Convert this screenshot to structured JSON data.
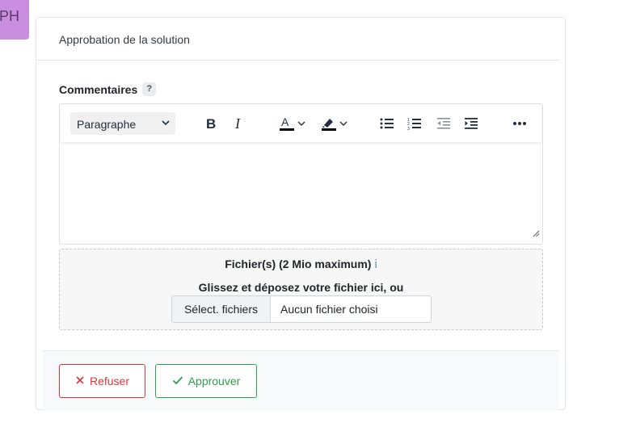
{
  "user": {
    "initials": "PH"
  },
  "card": {
    "title": "Approbation de la solution"
  },
  "comments": {
    "label": "Commentaires",
    "help": "?"
  },
  "editor": {
    "block_format": "Paragraphe",
    "text_color": "#000000",
    "highlight_color": "#000000"
  },
  "files": {
    "title": "Fichier(s) (2 Mio maximum)",
    "info": "i",
    "drop_text": "Glissez et déposez votre fichier ici, ou",
    "select_label": "Sélect. fichiers",
    "status": "Aucun fichier choisi"
  },
  "actions": {
    "refuse_label": "Refuser",
    "approve_label": "Approuver",
    "refuse_color": "#d9373e",
    "approve_color": "#2f9e4f"
  }
}
